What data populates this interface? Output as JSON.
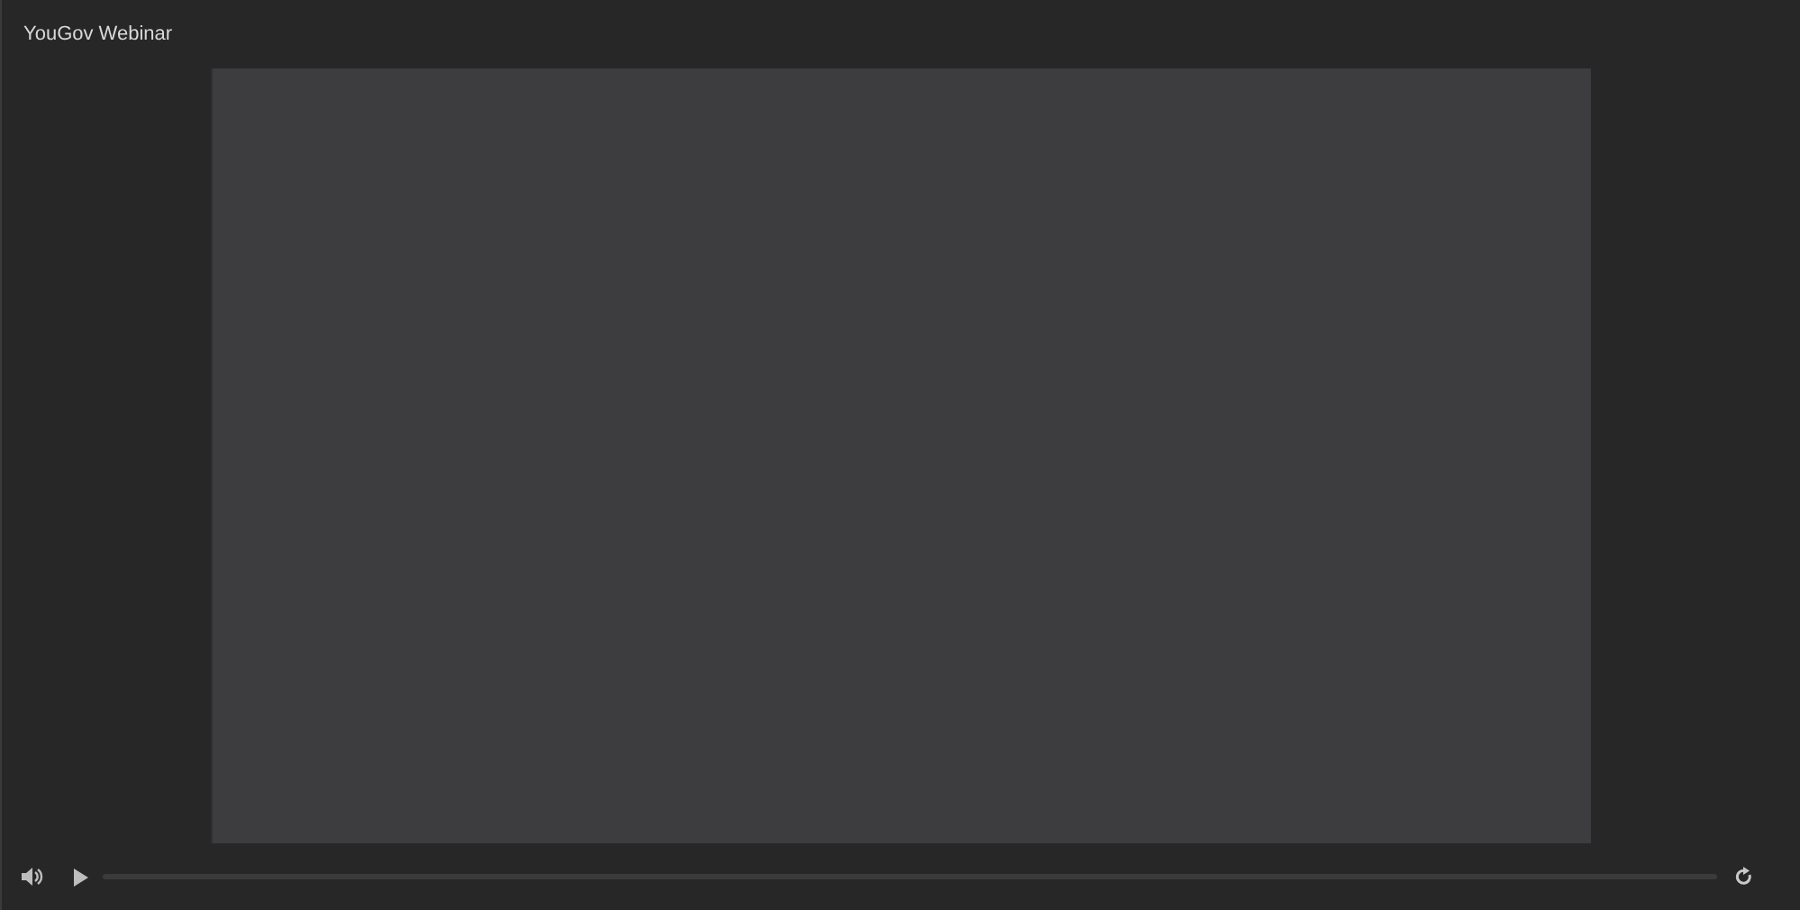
{
  "window": {
    "title": "YouGov Webinar"
  },
  "player": {
    "playing": false,
    "progress": {
      "level": 0
    }
  }
}
